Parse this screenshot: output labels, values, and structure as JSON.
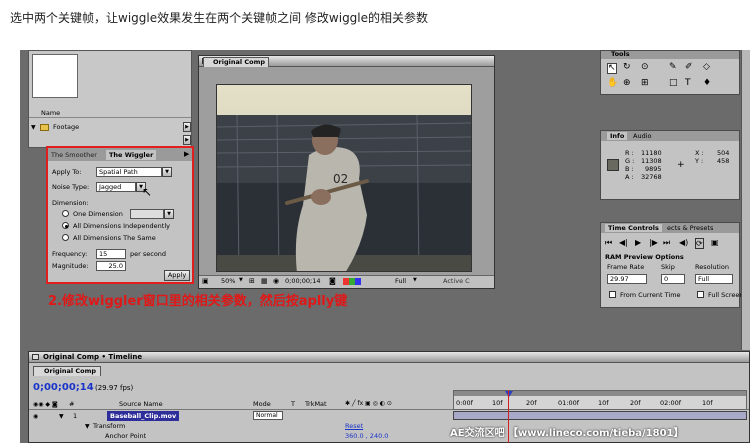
{
  "instruction": "选中两个关键帧，让wiggle效果发生在两个关键帧之间 修改wiggle的相关参数",
  "project": {
    "name_header": "Name",
    "footage_folder": "Footage"
  },
  "wiggler": {
    "tab_smoother": "The Smoother",
    "tab_wiggler": "The Wiggler",
    "apply_to_label": "Apply To:",
    "apply_to_value": "Spatial Path",
    "noise_type_label": "Noise Type:",
    "noise_type_value": "Jagged",
    "dimension_label": "Dimension:",
    "one_dimension": "One Dimension",
    "all_independent": "All Dimensions Independently",
    "all_same": "All Dimensions The Same",
    "frequency_label": "Frequency:",
    "frequency_value": "15",
    "frequency_unit": "per second",
    "magnitude_label": "Magnitude:",
    "magnitude_value": "25.0",
    "apply_button": "Apply"
  },
  "annotation": "2.修改wiggler窗口里的相关参数，然后按aplly键",
  "comp": {
    "title": "Original Comp",
    "zoom": "50%",
    "timecode": "0;00;00;14",
    "resolution": "Full",
    "camera": "Active C"
  },
  "tools": {
    "title": "Tools"
  },
  "info": {
    "tab_info": "Info",
    "tab_audio": "Audio",
    "r_label": "R :",
    "r_value": "11180",
    "g_label": "G :",
    "g_value": "11308",
    "b_label": "B :",
    "b_value": "9895",
    "a_label": "A :",
    "a_value": "32768",
    "x_label": "X :",
    "x_value": "504",
    "y_label": "Y :",
    "y_value": "458",
    "swatch_color": "#6a6960"
  },
  "time_controls": {
    "tab_time": "Time Controls",
    "tab_effects": "ects & Presets",
    "ram_preview": "RAM Preview Options",
    "frame_rate_label": "Frame Rate",
    "frame_rate_value": "29.97",
    "skip_label": "Skip",
    "skip_value": "0",
    "resolution_label": "Resolution",
    "resolution_value": "Full",
    "from_current": "From Current Time",
    "full_screen": "Full Screen"
  },
  "timeline": {
    "window_title": "Original Comp • Timeline",
    "tab": "Original Comp",
    "timecode": "0;00;00;14",
    "fps": "(29.97 fps)",
    "col_source": "Source Name",
    "col_mode": "Mode",
    "col_t": "T",
    "col_trkmat": "TrkMat",
    "layer_num": "1",
    "layer_name": "Baseball_Clip.mov",
    "layer_mode": "Normal",
    "transform": "Transform",
    "anchor_point": "Anchor Point",
    "reset": "Reset",
    "anchor_value": "360.0 , 240.0",
    "ruler": [
      "0:00f",
      "10f",
      "20f",
      "01:00f",
      "10f",
      "20f",
      "02:00f",
      "10f"
    ]
  },
  "watermark": "AE交流区吧 【www.lineco.com/tieba/1801】"
}
